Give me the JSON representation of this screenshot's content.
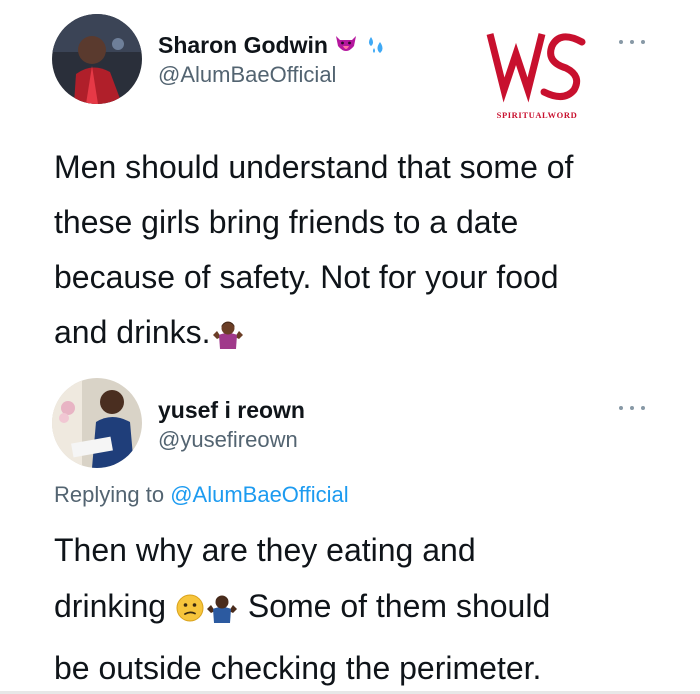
{
  "tweet": {
    "author_name": "Sharon Godwin",
    "author_handle": "@AlumBaeOfficial",
    "name_emojis": [
      "tongue-face-icon",
      "sweat-droplets-icon"
    ],
    "lines": [
      "Men should understand that some of",
      "these girls bring friends to a date",
      "because of safety. Not for your food",
      "and drinks."
    ],
    "trailing_emoji": "woman-shrugging-icon"
  },
  "watermark": {
    "logo_letters": "SW",
    "logo_caption": "SPIRITUALWORD",
    "accent_color": "#c8102e"
  },
  "reply": {
    "author_name": "yusef i reown",
    "author_handle": "@yusefireown",
    "replying_prefix": "Replying to",
    "replying_to": "@AlumBaeOfficial",
    "line1": "Then why are they eating and",
    "line2_a": "drinking",
    "line2_b": "Some of them should",
    "line3": "be outside checking the perimeter.",
    "emojis": [
      "confused-face-icon",
      "man-shrugging-icon"
    ]
  },
  "colors": {
    "text": "#0f1419",
    "secondary": "#536471",
    "link": "#1d9bf0"
  }
}
